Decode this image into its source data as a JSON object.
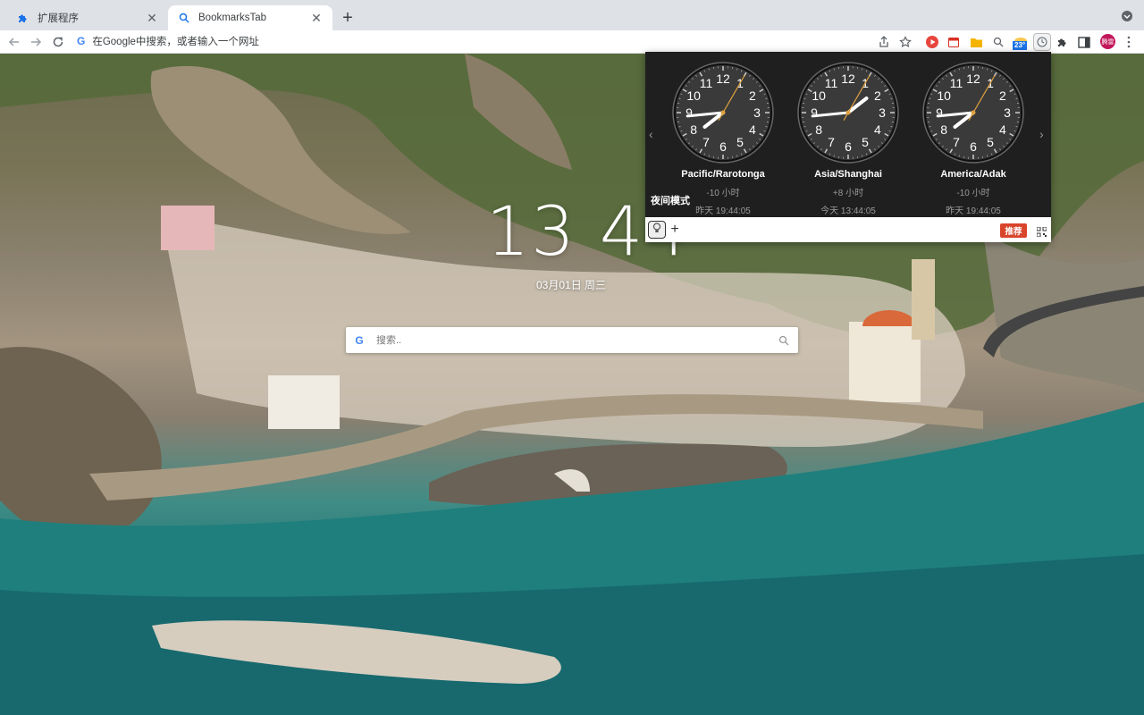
{
  "tabs": [
    {
      "title": "扩展程序",
      "icon": "puzzle-icon",
      "active": false
    },
    {
      "title": "BookmarksTab",
      "icon": "search-icon",
      "active": true
    }
  ],
  "omnibox": {
    "placeholder": "在Google中搜索，或者输入一个网址",
    "google_letter": "G"
  },
  "toolbar": {
    "weather_badge": "23°",
    "profile_initials": "腾雷",
    "extensions": [
      "play-icon",
      "calendar-icon",
      "folder-icon",
      "magnifier-icon",
      "weather-icon",
      "world-clock-icon",
      "puzzle-icon",
      "sidepanel-icon"
    ]
  },
  "page": {
    "time": "13 44",
    "date": "03月01日 周三",
    "search": {
      "placeholder": "搜索..",
      "google_letter": "G"
    }
  },
  "world_clock": {
    "clocks": [
      {
        "zone": "Pacific/Rarotonga",
        "offset": "-10 小时",
        "when": "昨天 19:44:05",
        "hour": 19,
        "minute": 44,
        "second": 5
      },
      {
        "zone": "Asia/Shanghai",
        "offset": "+8 小时",
        "when": "今天 13:44:05",
        "hour": 13,
        "minute": 44,
        "second": 5
      },
      {
        "zone": "America/Adak",
        "offset": "-10 小时",
        "when": "昨天 19:44:05",
        "hour": 19,
        "minute": 44,
        "second": 5
      }
    ],
    "tooltip": "夜间模式",
    "recommend_label": "推荐",
    "add_label": "+",
    "prev_label": "‹",
    "next_label": "›"
  },
  "colors": {
    "accent_red": "#d9452b",
    "popup_bg": "#1f1f1f",
    "second_hand": "#e0a040"
  }
}
